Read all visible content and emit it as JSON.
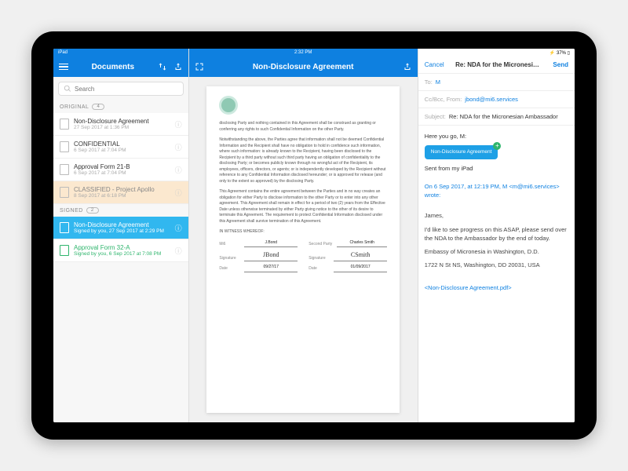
{
  "status_left": {
    "ipad": "iPad",
    "wifi": "●"
  },
  "status_center": {
    "time": "2:32 PM"
  },
  "status_right": {
    "bt": "⚡ 37% ▯"
  },
  "sidebar": {
    "title": "Documents",
    "search_placeholder": "Search",
    "sections": [
      {
        "label": "ORIGINAL",
        "count": "4"
      },
      {
        "label": "SIGNED",
        "count": "2"
      }
    ],
    "original": [
      {
        "title": "Non-Disclosure Agreement",
        "sub": "27 Sep 2017 at 1:36 PM"
      },
      {
        "title": "CONFIDENTIAL",
        "sub": "6 Sep 2017 at 7:04 PM"
      },
      {
        "title": "Approval Form 21-B",
        "sub": "6 Sep 2017 at 7:04 PM"
      },
      {
        "title": "CLASSIFIED - Project Apollo",
        "sub": "8 Sep 2017 at 6:18 PM"
      }
    ],
    "signed": [
      {
        "title": "Non-Disclosure Agreement",
        "sub": "Signed by you, 27 Sep 2017 at 2:29 PM"
      },
      {
        "title": "Approval Form 32-A",
        "sub": "Signed by you, 6 Sep 2017 at 7:08 PM"
      }
    ]
  },
  "center": {
    "title": "Non-Disclosure Agreement",
    "para1": "disclosing Party and nothing contained in this Agreement shall be construed as granting or conferring any rights to such Confidential Information on the other Party.",
    "para2": "Notwithstanding the above, the Parties agree that information shall not be deemed Confidential Information and the Recipient shall have no obligation to hold in confidence such information, where such information: is already known to the Recipient, having been disclosed to the Recipient by a third party without such third party having an obligation of confidentiality to the disclosing Party; or becomes publicly known through no wrongful act of the Recipient, its employees, officers, directors, or agents; or is independently developed by the Recipient without reference to any Confidential Information disclosed hereunder; or is approved for release (and only to the extent so approved) by the disclosing Party.",
    "para3": "This Agreement contains the entire agreement between the Parties and in no way creates an obligation for either Party to disclose information to the other Party or to enter into any other agreement. This Agreement shall remain in effect for a period of two (2) years from the Effective Date unless otherwise terminated by either Party giving notice to the other of its desire to terminate this Agreement. The requirement to protect Confidential Information disclosed under this Agreement shall survive termination of this Agreement.",
    "witness": "IN WITNESS WHEREOF:",
    "sig": {
      "mi6_label": "Mi6",
      "mi6_name": "J.Bond",
      "second_label": "Second Party",
      "second_name": "Charles Smith",
      "sig_label": "Signature",
      "date_label": "Date",
      "date1": "09/27/17",
      "date2": "01/09/2017",
      "scribble1": "JBond",
      "scribble2": "CSmith"
    }
  },
  "mail": {
    "cancel": "Cancel",
    "title": "Re: NDA for the Micronesian…",
    "send": "Send",
    "to_label": "To:",
    "to_value": "M",
    "cc_label": "Cc/Bcc, From:",
    "cc_value": "jbond@mi6.services",
    "subject_label": "Subject:",
    "subject_value": "Re: NDA for the Micronesian Ambassador",
    "greeting": "Here you go, M:",
    "attachment": "Non-Disclosure Agreement",
    "signature": "Sent from my iPad",
    "quote_header": "On 6 Sep 2017, at 12:19 PM, M <m@mi6.services> wrote:",
    "quote_greet": "James,",
    "quote_body": "I'd like to see progress on this ASAP, please send over the NDA to the Ambassador by the end of today.",
    "quote_addr1": "Embassy of Micronesia in Washington, D.D.",
    "quote_addr2": "1722 N St NS, Washington, DD 20031, USA",
    "quote_attach": "<Non-Disclosure Agreement.pdf>"
  }
}
